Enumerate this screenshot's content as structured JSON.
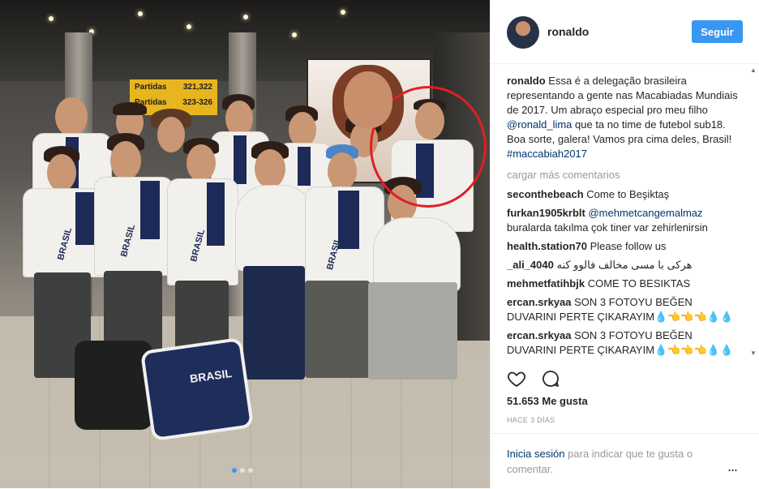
{
  "post": {
    "username": "ronaldo",
    "follow_label": "Seguir",
    "caption_user": "ronaldo",
    "caption_part1": " Essa é a delegação brasileira representando a gente nas Macabiadas Mundiais de 2017. Um abraço especial pro meu filho ",
    "caption_mention": "@ronald_lima",
    "caption_part2": " que ta no time de futebol sub18. Boa sorte, galera! Vamos pra cima deles, Brasil! ",
    "caption_hashtag": "#maccabiah2017",
    "load_more": "cargar más comentarios",
    "likes": "51.653 Me gusta",
    "time_ago": "HACE 3 DÍAS",
    "login_link": "Inicia sesión",
    "login_text": " para indicar que te gusta o comentar.",
    "more_options": "...",
    "image_carousel": {
      "slides": 3,
      "active": 1
    }
  },
  "photo": {
    "sign_line1_left": "Partidas",
    "sign_line1_right": "321,322",
    "sign_line2_left": "Partidas",
    "sign_line2_right": "323-326",
    "jacket_text": "BRASIL",
    "bag_text": "BRASIL"
  },
  "comments": [
    {
      "user": "secontheb each",
      "text": "Come to Beşiktaş"
    },
    {
      "user": "furkan1905krblt",
      "mention": "@mehmetcangemalmaz",
      "text": " buralarda takılma çok tiner var zehirlenirsin"
    },
    {
      "user": "health.station70",
      "text": "Please follow us"
    },
    {
      "user": "_ali_4040",
      "text": "هرکی با مسی مخالف فالوو کنه"
    },
    {
      "user": "mehmetfatihbjk",
      "text": "COME TO BESIKTAS"
    },
    {
      "user": "ercan.srkyaa",
      "text": "SON 3 FOTOYU BEĞEN DUVARINI PERTE ÇIKARAYIM💧👈👈👈💧💧"
    },
    {
      "user": "ercan.srkyaa",
      "text": "SON 3 FOTOYU BEĞEN DUVARINI PERTE ÇIKARAYIM💧👈👈👈💧💧"
    }
  ],
  "colors": {
    "follow": "#3897f0",
    "mention": "#003569",
    "highlight_circle": "#e11e25"
  }
}
